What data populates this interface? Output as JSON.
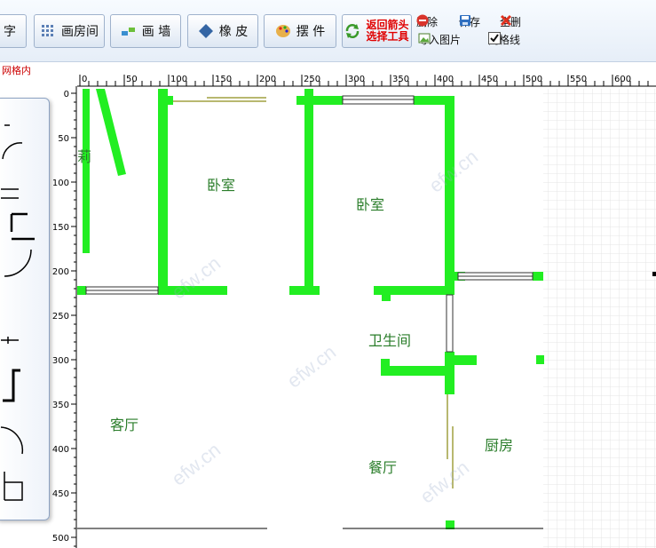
{
  "toolbar": {
    "text_btn": "字",
    "room_btn": "画房间",
    "wall_btn": "画 墙",
    "eraser_btn": "橡 皮",
    "furniture_btn": "摆 件",
    "return_btn_line1": "返回箭头",
    "return_btn_line2": "选择工具",
    "delete_btn": "删除",
    "save_btn": "保存",
    "delete_all_btn": "全删",
    "import_btn": "导入图片",
    "grid_toggle": "网格线",
    "grid_checked": true,
    "accent_text_color": "#e00000"
  },
  "status_label": "网格内",
  "ruler": {
    "x_ticks": [
      "0",
      "50",
      "100",
      "150",
      "200",
      "250",
      "300",
      "350",
      "400",
      "450",
      "500",
      "550",
      "600"
    ],
    "y_ticks": [
      "0",
      "50",
      "100",
      "150",
      "200",
      "250",
      "300",
      "350",
      "400",
      "450",
      "500"
    ]
  },
  "rooms": {
    "bedroom_left": "卧室",
    "bedroom_right": "卧室",
    "bathroom": "卫生间",
    "living_room": "客厅",
    "dining_room": "餐厅",
    "kitchen": "厨房",
    "partial_label": "莉"
  },
  "watermark": "efw.cn",
  "colors": {
    "wall": "#22ee22",
    "grid": "#e4e4e4",
    "ruler_text": "#000000",
    "room_label": "#2a7d2a"
  }
}
